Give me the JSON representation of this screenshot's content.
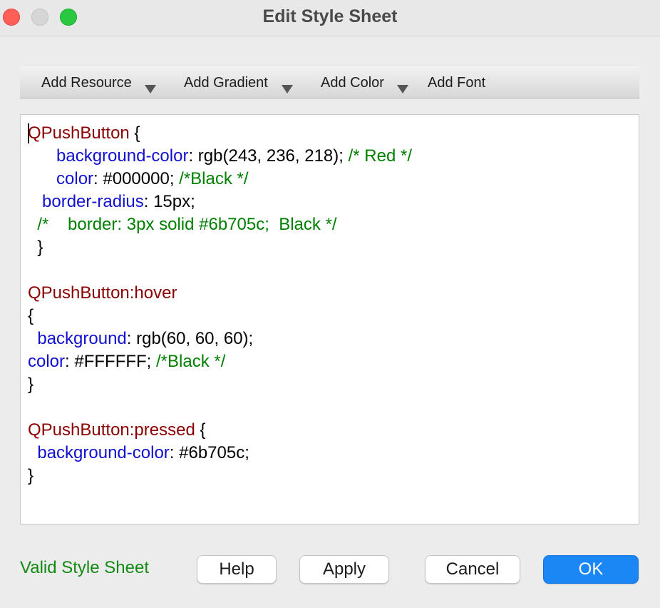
{
  "window": {
    "title": "Edit Style Sheet"
  },
  "toolbar": {
    "items": [
      {
        "label": "Add Resource",
        "has_dropdown": true
      },
      {
        "label": "Add Gradient",
        "has_dropdown": true
      },
      {
        "label": "Add Color",
        "has_dropdown": true
      },
      {
        "label": "Add Font",
        "has_dropdown": false
      }
    ]
  },
  "editor": {
    "lines": [
      [
        {
          "t": "QPushButton",
          "k": "sel"
        },
        {
          "t": " {",
          "k": "val"
        }
      ],
      [
        {
          "t": "      ",
          "k": "val"
        },
        {
          "t": "background-color",
          "k": "prop"
        },
        {
          "t": ": rgb(243, 236, 218); ",
          "k": "val"
        },
        {
          "t": "/* Red */",
          "k": "cmt"
        }
      ],
      [
        {
          "t": "      ",
          "k": "val"
        },
        {
          "t": "color",
          "k": "prop"
        },
        {
          "t": ": #000000; ",
          "k": "val"
        },
        {
          "t": "/*Black */",
          "k": "cmt"
        }
      ],
      [
        {
          "t": "   ",
          "k": "val"
        },
        {
          "t": "border-radius",
          "k": "prop"
        },
        {
          "t": ": 15px;",
          "k": "val"
        }
      ],
      [
        {
          "t": "  ",
          "k": "val"
        },
        {
          "t": "/*    border: 3px solid #6b705c;  Black */",
          "k": "cmt"
        }
      ],
      [
        {
          "t": "  }",
          "k": "val"
        }
      ],
      [],
      [
        {
          "t": "QPushButton:hover",
          "k": "sel"
        }
      ],
      [
        {
          "t": "{",
          "k": "val"
        }
      ],
      [
        {
          "t": "  ",
          "k": "val"
        },
        {
          "t": "background",
          "k": "prop"
        },
        {
          "t": ": rgb(60, 60, 60);",
          "k": "val"
        }
      ],
      [
        {
          "t": "color",
          "k": "prop"
        },
        {
          "t": ": #FFFFFF; ",
          "k": "val"
        },
        {
          "t": "/*Black */",
          "k": "cmt"
        }
      ],
      [
        {
          "t": "}",
          "k": "val"
        }
      ],
      [],
      [
        {
          "t": "QPushButton:pressed",
          "k": "sel"
        },
        {
          "t": " {",
          "k": "val"
        }
      ],
      [
        {
          "t": "  ",
          "k": "val"
        },
        {
          "t": "background-color",
          "k": "prop"
        },
        {
          "t": ": #6b705c;",
          "k": "val"
        }
      ],
      [
        {
          "t": "}",
          "k": "val"
        }
      ]
    ]
  },
  "footer": {
    "status": "Valid Style Sheet",
    "help_label": "Help",
    "apply_label": "Apply",
    "cancel_label": "Cancel",
    "ok_label": "OK"
  },
  "colors": {
    "selector": "#8b0000",
    "property": "#1010d0",
    "comment": "#008000",
    "status": "#128a12",
    "primary_button": "#1a87f5"
  }
}
